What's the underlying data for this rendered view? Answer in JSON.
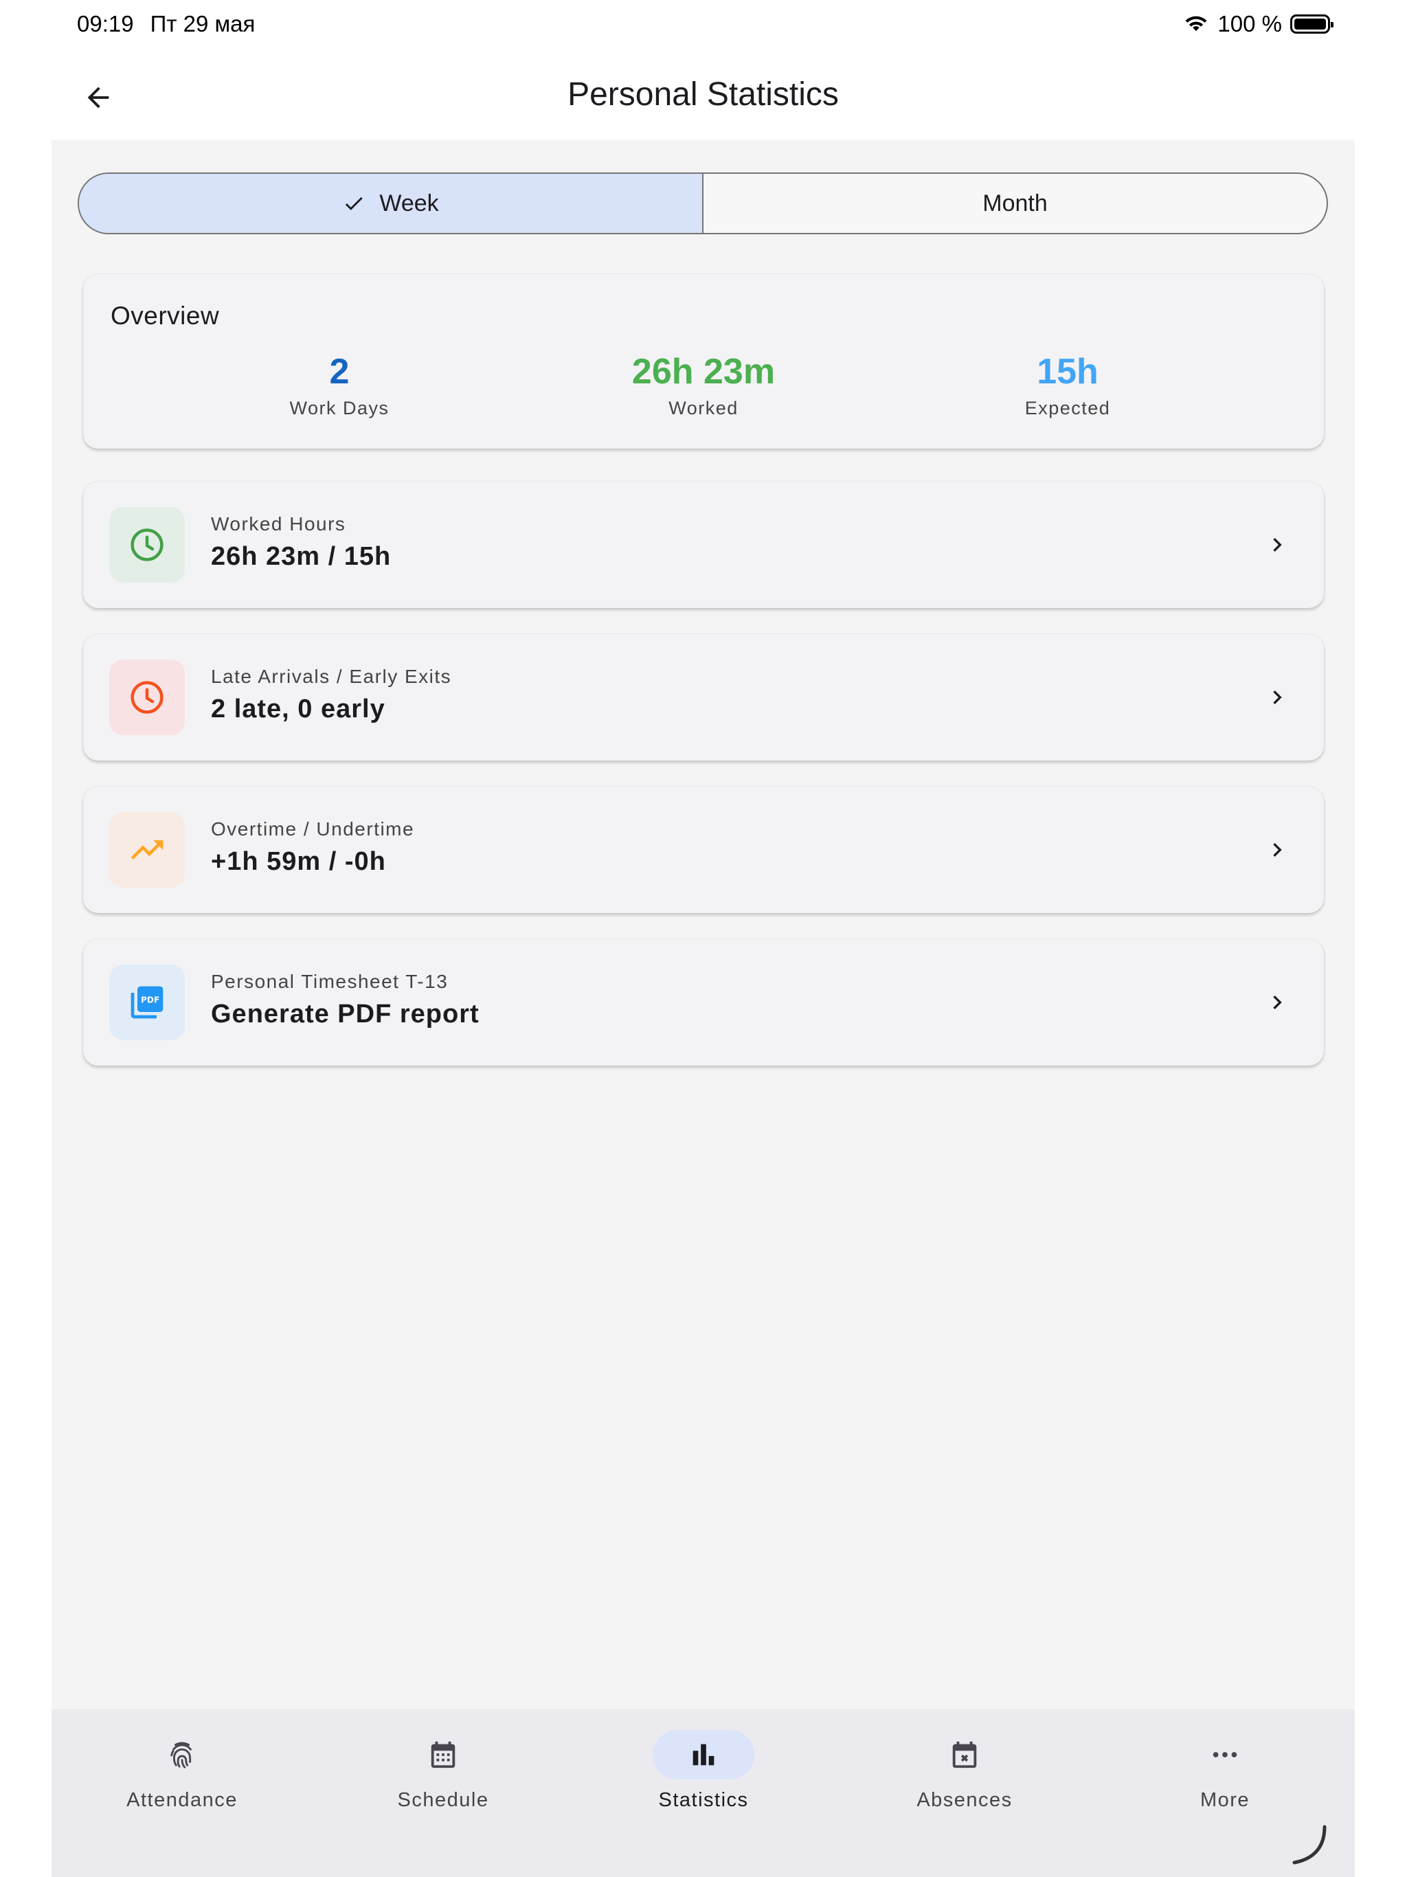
{
  "status_bar": {
    "time": "09:19",
    "date": "Пт 29 мая",
    "battery": "100 %"
  },
  "header": {
    "title": "Personal Statistics"
  },
  "period_toggle": {
    "week": "Week",
    "month": "Month",
    "selected": "Week"
  },
  "overview": {
    "title": "Overview",
    "stats": [
      {
        "value": "2",
        "label": "Work Days",
        "color": "#1565c0"
      },
      {
        "value": "26h 23m",
        "label": "Worked",
        "color": "#4caf50"
      },
      {
        "value": "15h",
        "label": "Expected",
        "color": "#42a5f5"
      }
    ]
  },
  "rows": [
    {
      "icon": "clock-icon",
      "subtitle": "Worked Hours",
      "value": "26h 23m / 15h",
      "icon_color": "#43a047",
      "icon_bg": "#e3efe6"
    },
    {
      "icon": "clock-alert-icon",
      "subtitle": "Late Arrivals / Early Exits",
      "value": "2 late, 0 early",
      "icon_color": "#f4511e",
      "icon_bg": "#f8e2e4"
    },
    {
      "icon": "trending-up-icon",
      "subtitle": "Overtime / Undertime",
      "value": "+1h 59m / -0h",
      "icon_color": "#ffa726",
      "icon_bg": "#f7ebe4"
    },
    {
      "icon": "pdf-icon",
      "subtitle": "Personal Timesheet T-13",
      "value": "Generate PDF report",
      "icon_color": "#2196f3",
      "icon_bg": "#e1ecf8"
    }
  ],
  "nav": {
    "items": [
      {
        "label": "Attendance",
        "icon": "fingerprint-icon"
      },
      {
        "label": "Schedule",
        "icon": "calendar-icon"
      },
      {
        "label": "Statistics",
        "icon": "bar-chart-icon"
      },
      {
        "label": "Absences",
        "icon": "calendar-x-icon"
      },
      {
        "label": "More",
        "icon": "more-icon"
      }
    ],
    "active": "Statistics"
  }
}
